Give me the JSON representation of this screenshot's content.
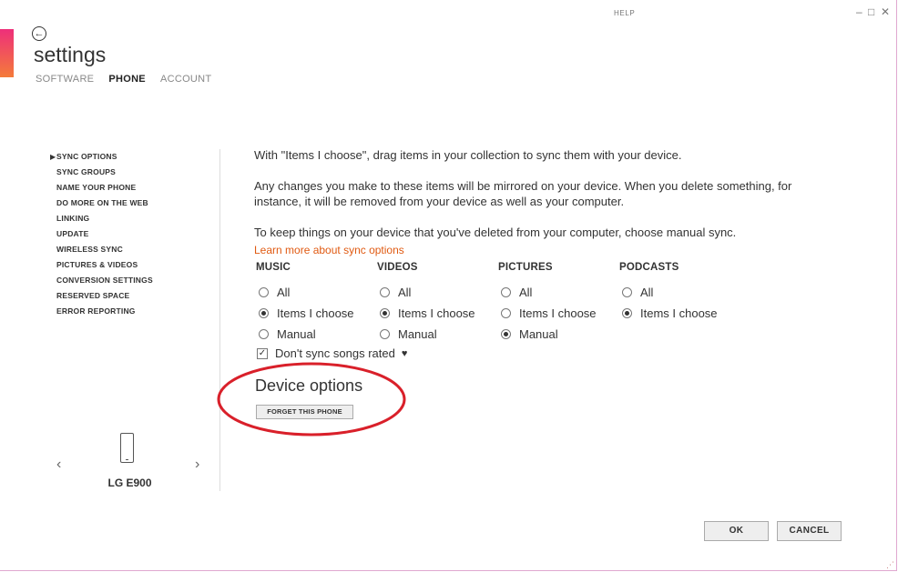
{
  "window": {
    "help_label": "HELP",
    "minimize_glyph": "–",
    "maximize_glyph": "□",
    "close_glyph": "✕"
  },
  "header": {
    "back_glyph": "←",
    "title": "settings",
    "tabs": [
      {
        "label": "SOFTWARE",
        "active": false
      },
      {
        "label": "PHONE",
        "active": true
      },
      {
        "label": "ACCOUNT",
        "active": false
      }
    ]
  },
  "sidebar": {
    "items": [
      {
        "label": "SYNC OPTIONS",
        "selected": true
      },
      {
        "label": "SYNC GROUPS"
      },
      {
        "label": "NAME YOUR PHONE"
      },
      {
        "label": "DO MORE ON THE WEB"
      },
      {
        "label": "LINKING"
      },
      {
        "label": "UPDATE"
      },
      {
        "label": "WIRELESS SYNC"
      },
      {
        "label": "PICTURES & VIDEOS"
      },
      {
        "label": "CONVERSION SETTINGS"
      },
      {
        "label": "RESERVED SPACE"
      },
      {
        "label": "ERROR REPORTING"
      }
    ],
    "device": {
      "name": "LG E900",
      "prev_glyph": "‹",
      "next_glyph": "›"
    }
  },
  "main": {
    "intro": "With \"Items I choose\", drag items in your collection to sync them with your device.",
    "mirror_text": "Any changes you make to these items will be mirrored on your device. When you delete something, for instance, it will be removed from your device as well as your computer.",
    "manual_text": "To keep things on your device that you've deleted from your computer, choose manual sync.",
    "learn_more": "Learn more about sync options",
    "columns": [
      {
        "heading": "MUSIC",
        "options": [
          {
            "label": "All",
            "selected": false
          },
          {
            "label": "Items I choose",
            "selected": true
          },
          {
            "label": "Manual",
            "selected": false
          }
        ]
      },
      {
        "heading": "VIDEOS",
        "options": [
          {
            "label": "All",
            "selected": false
          },
          {
            "label": "Items I choose",
            "selected": true
          },
          {
            "label": "Manual",
            "selected": false
          }
        ]
      },
      {
        "heading": "PICTURES",
        "options": [
          {
            "label": "All",
            "selected": false
          },
          {
            "label": "Items I choose",
            "selected": false
          },
          {
            "label": "Manual",
            "selected": true
          }
        ]
      },
      {
        "heading": "PODCASTS",
        "options": [
          {
            "label": "All",
            "selected": false
          },
          {
            "label": "Items I choose",
            "selected": true
          }
        ]
      }
    ],
    "dont_sync": {
      "label": "Don't sync songs rated",
      "checked": true,
      "check_glyph": "✓",
      "icon_glyph": "♥"
    },
    "device_options_heading": "Device options",
    "forget_button": "FORGET THIS PHONE"
  },
  "footer": {
    "ok_label": "OK",
    "cancel_label": "CANCEL"
  },
  "colors": {
    "accent_gradient_top": "#ee2f7a",
    "accent_gradient_bottom": "#f47b3a",
    "link": "#e05a12",
    "annotation": "#d9202a"
  }
}
